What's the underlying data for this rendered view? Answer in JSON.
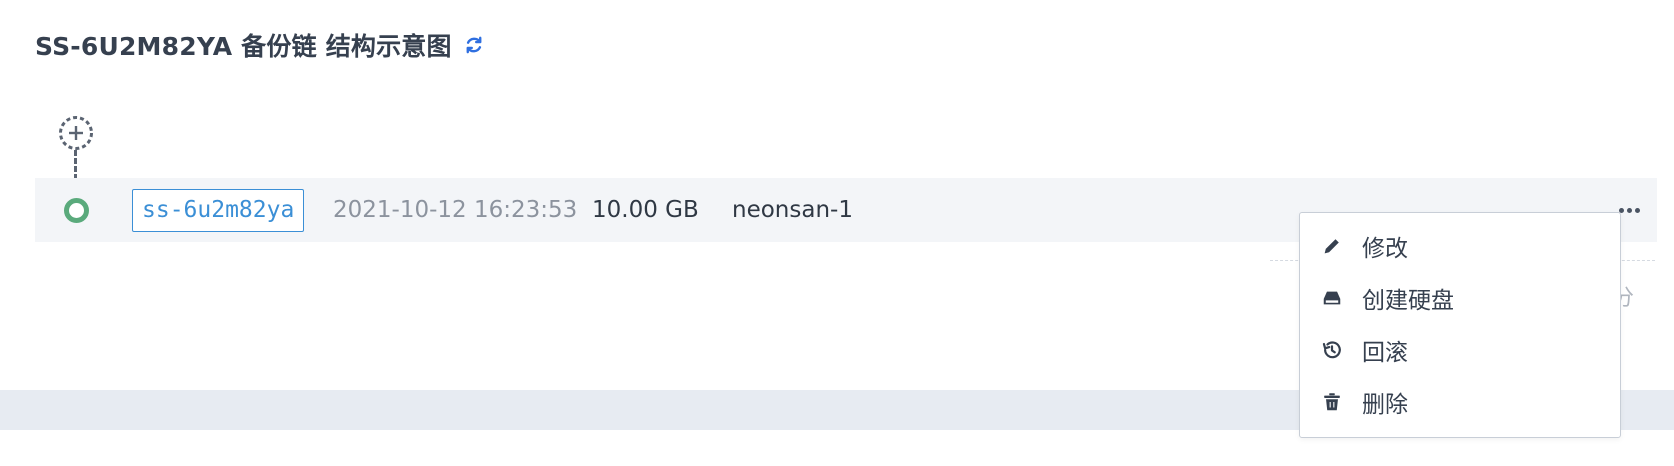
{
  "page": {
    "title": "SS-6U2M82YA 备份链 结构示意图",
    "refresh_icon": "refresh-icon"
  },
  "chain": {
    "add_icon": "add-circle-dashed-icon",
    "snapshot": {
      "id": "ss-6u2m82ya",
      "created_at": "2021-10-12 16:23:53",
      "size": "10.00 GB",
      "pool": "neonsan-1",
      "status_color": "#5aaa7c"
    },
    "more_icon": "more-horizontal-icon"
  },
  "behind_text": "分",
  "menu": {
    "items": [
      {
        "label": "修改",
        "icon": "pencil-icon"
      },
      {
        "label": "创建硬盘",
        "icon": "disk-icon"
      },
      {
        "label": "回滚",
        "icon": "history-icon"
      },
      {
        "label": "删除",
        "icon": "trash-icon"
      }
    ]
  },
  "colors": {
    "accent": "#3b8fd6",
    "refresh": "#2f6fe0",
    "status_ok": "#5aaa7c",
    "row_bg": "#f3f5f8",
    "footer_bg": "#e7ebf2"
  }
}
